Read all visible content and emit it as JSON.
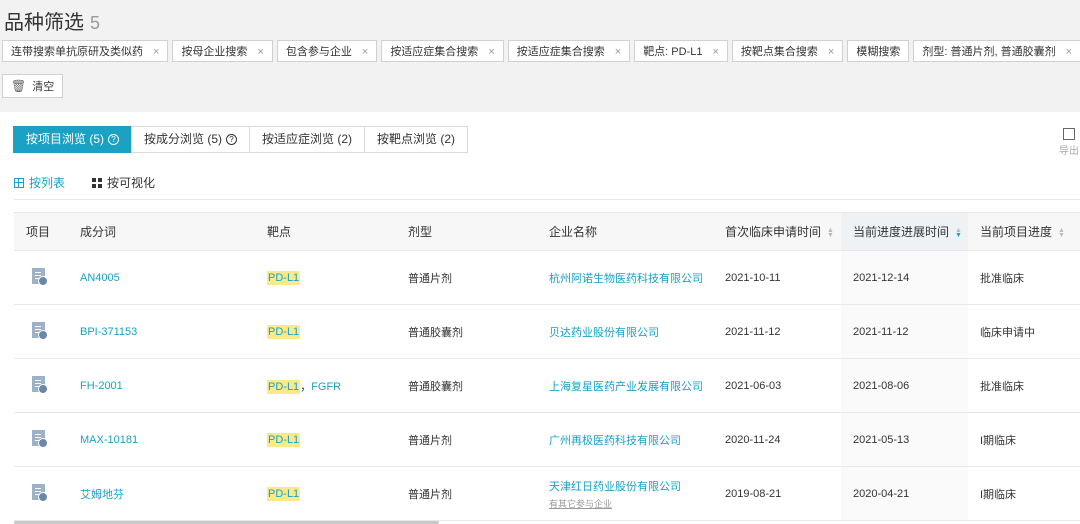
{
  "header": {
    "title": "品种筛选",
    "count": "5"
  },
  "tags": [
    {
      "label": "连带搜索单抗原研及类似药"
    },
    {
      "label": "按母企业搜索"
    },
    {
      "label": "包含参与企业"
    },
    {
      "label": "按适应症集合搜索"
    },
    {
      "label": "按适应症集合搜索"
    },
    {
      "label": "靶点: PD-L1"
    },
    {
      "label": "按靶点集合搜索"
    },
    {
      "label": "模糊搜索",
      "no_close": true
    },
    {
      "label": "剂型: 普通片剂, 普通胶囊剂"
    }
  ],
  "tag_close": "×",
  "clear": {
    "label": "清空"
  },
  "view_tabs": [
    {
      "label": "按项目浏览 (5)",
      "help": "?"
    },
    {
      "label": "按成分浏览 (5)",
      "help": "?"
    },
    {
      "label": "按适应症浏览 (2)"
    },
    {
      "label": "按靶点浏览 (2)"
    }
  ],
  "export": {
    "label": "导出"
  },
  "modes": {
    "list": "按列表",
    "visual": "按可视化"
  },
  "table": {
    "columns": [
      "项目",
      "成分词",
      "靶点",
      "剂型",
      "企业名称",
      "首次临床申请时间",
      "当前进度进展时间",
      "当前项目进度"
    ],
    "rows": [
      {
        "ingredient": "AN4005",
        "target": "PD-L1",
        "target_extra": "",
        "dosage": "普通片剂",
        "company": "杭州阿诺生物医药科技有限公司",
        "sub": "",
        "first": "2021-10-11",
        "progress_time": "2021-12-14",
        "status": "批准临床"
      },
      {
        "ingredient": "BPI-371153",
        "target": "PD-L1",
        "target_extra": "",
        "dosage": "普通胶囊剂",
        "company": "贝达药业股份有限公司",
        "sub": "",
        "first": "2021-11-12",
        "progress_time": "2021-11-12",
        "status": "临床申请中"
      },
      {
        "ingredient": "FH-2001",
        "target": "PD-L1",
        "target_extra": "FGFR",
        "dosage": "普通胶囊剂",
        "company": "上海复星医药产业发展有限公司",
        "sub": "",
        "first": "2021-06-03",
        "progress_time": "2021-08-06",
        "status": "批准临床"
      },
      {
        "ingredient": "MAX-10181",
        "target": "PD-L1",
        "target_extra": "",
        "dosage": "普通片剂",
        "company": "广州再极医药科技有限公司",
        "sub": "",
        "first": "2020-11-24",
        "progress_time": "2021-05-13",
        "status": "I期临床"
      },
      {
        "ingredient": "艾姆地芬",
        "target": "PD-L1",
        "target_extra": "",
        "dosage": "普通片剂",
        "company": "天津红日药业股份有限公司",
        "sub": "有其它参与企业",
        "first": "2019-08-21",
        "progress_time": "2020-04-21",
        "status": "I期临床"
      }
    ]
  }
}
